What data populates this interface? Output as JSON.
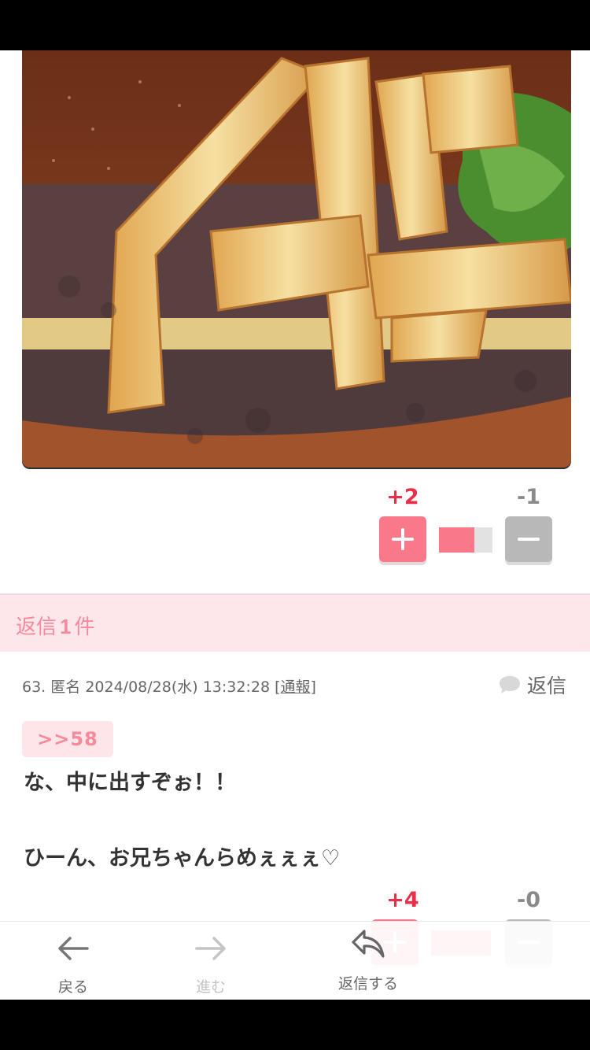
{
  "post_top": {
    "votes": {
      "plus": "+2",
      "minus": "-1",
      "ratio": 0.667
    }
  },
  "replies_header": {
    "prefix": "返信",
    "count": "1",
    "suffix": "件"
  },
  "comment": {
    "number": "63.",
    "author": "匿名",
    "datetime": "2024/08/28(水) 13:32:28",
    "report_open": "[",
    "report_label": "通報",
    "report_close": "]",
    "reply_label": "返信",
    "anchor": ">>58",
    "lines": [
      "な、中に出すぞぉ！！",
      "ひーん、お兄ちゃんらめぇぇぇ♡"
    ],
    "votes": {
      "plus": "+4",
      "minus": "-0",
      "ratio": 1.0
    }
  },
  "nav": {
    "back": "戻る",
    "forward": "進む",
    "reply": "返信する"
  },
  "colors": {
    "accent": "#f9788a",
    "plus": "#e8304a",
    "minus": "#8a8a8a",
    "reply_bg": "#fde7eb"
  },
  "icons": [
    "plus-icon",
    "minus-icon",
    "speech-bubble-icon",
    "arrow-left-icon",
    "arrow-right-icon",
    "reply-arrow-icon"
  ]
}
